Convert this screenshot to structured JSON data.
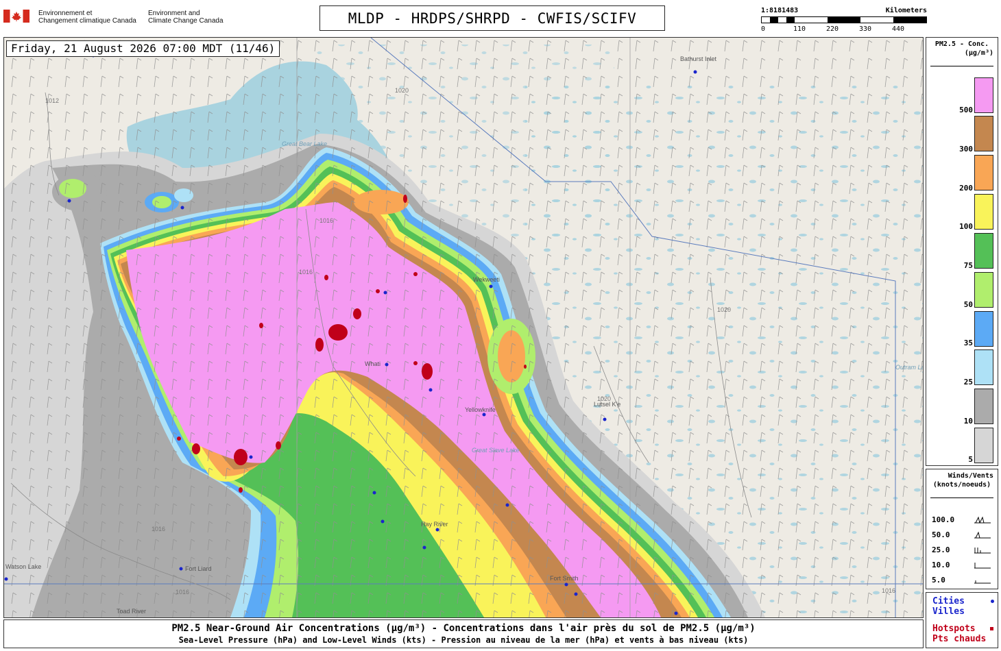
{
  "header": {
    "agency_fr_line1": "Environnement et",
    "agency_fr_line2": "Changement climatique Canada",
    "agency_en_line1": "Environment and",
    "agency_en_line2": "Climate Change Canada",
    "title": "MLDP - HRDPS/SHRPD - CWFIS/SCIFV",
    "flag_color": "#d52b1e"
  },
  "scale": {
    "ratio": "1:8181483",
    "unit": "Kilometers",
    "ticks": [
      "0",
      "110",
      "220",
      "330",
      "440"
    ]
  },
  "map": {
    "datetime": "Friday, 21 August 2026 07:00 MDT (11/46)",
    "cities": [
      "Bathurst Inlet",
      "Wekweeti",
      "Whati",
      "Yellowknife",
      "Lutsel K'e",
      "Hay River",
      "Fort Smith",
      "Fort Liard",
      "Toad River",
      "Great Slave Lake",
      "Great Bear Lake",
      "Outram Lake",
      "Watson Lake"
    ],
    "isobars": [
      "1012",
      "1016",
      "1020"
    ],
    "colors": {
      "land": "#eeebe4",
      "water": "#a9d3df",
      "city_marker": "#1a25cc",
      "hotspot": "#c0001a"
    }
  },
  "legend_pm": {
    "title_line1": "PM2.5 - Conc.",
    "title_line2": "(µg/m³)",
    "bins": [
      {
        "label": "500",
        "color": "#f59af2"
      },
      {
        "label": "300",
        "color": "#c4874f"
      },
      {
        "label": "200",
        "color": "#f9a655"
      },
      {
        "label": "100",
        "color": "#f9f35a"
      },
      {
        "label": "75",
        "color": "#54c057"
      },
      {
        "label": "50",
        "color": "#b0ee6d"
      },
      {
        "label": "35",
        "color": "#5caaf5"
      },
      {
        "label": "25",
        "color": "#aee1f6"
      },
      {
        "label": "10",
        "color": "#ababab"
      },
      {
        "label": "5",
        "color": "#d6d6d6"
      }
    ]
  },
  "legend_wind": {
    "title_line1": "Winds/Vents",
    "title_line2": "(knots/noeuds)",
    "rows": [
      "100.0",
      "50.0",
      "25.0",
      "10.0",
      "5.0"
    ]
  },
  "legend_misc": {
    "cities_en": "Cities",
    "cities_fr": "Villes",
    "hotspots_en": "Hotspots",
    "hotspots_fr": "Pts chauds",
    "cities_color": "#1a25cc",
    "hotspots_color": "#c0001a"
  },
  "footer": {
    "line1": "PM2.5 Near-Ground Air Concentrations (µg/m³) - Concentrations dans l'air près du sol de PM2.5 (µg/m³)",
    "line2": "Sea-Level Pressure (hPa) and Low-Level Winds (kts) - Pression au niveau de la mer (hPa) et vents à bas niveau (kts)"
  }
}
